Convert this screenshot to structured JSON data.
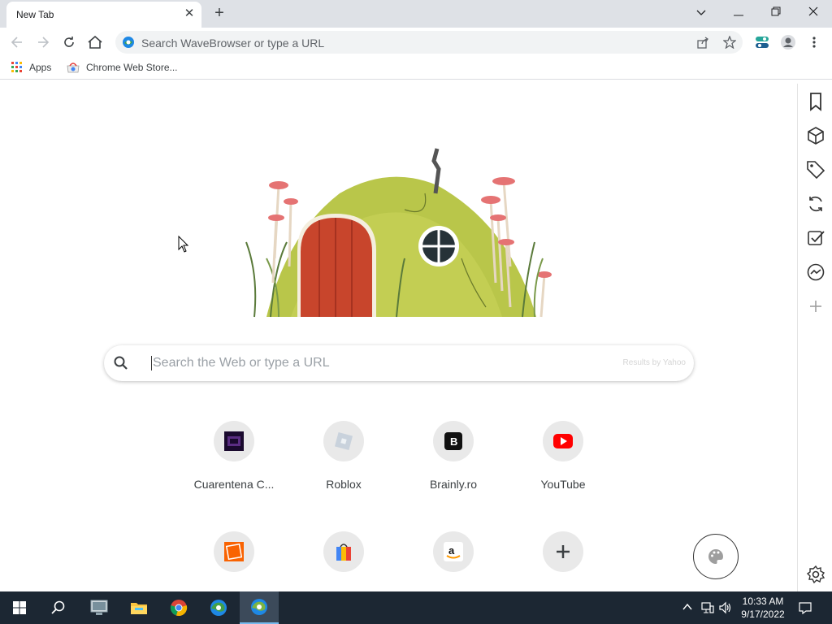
{
  "tab": {
    "title": "New Tab"
  },
  "window_controls": [
    "minimize",
    "restore",
    "close"
  ],
  "omnibox": {
    "placeholder": "Search WaveBrowser or type a URL"
  },
  "bookmarks": [
    {
      "label": "Apps",
      "icon": "apps-grid-icon"
    },
    {
      "label": "Chrome Web Store...",
      "icon": "chrome-web-store-icon"
    }
  ],
  "search": {
    "placeholder": "Search the Web or type a URL",
    "attribution": "Results by Yahoo"
  },
  "shortcuts": [
    {
      "label": "Cuarentena C...",
      "icon": "cuarentena-favicon"
    },
    {
      "label": "Roblox",
      "icon": "roblox-favicon"
    },
    {
      "label": "Brainly.ro",
      "icon": "brainly-favicon"
    },
    {
      "label": "YouTube",
      "icon": "youtube-favicon"
    },
    {
      "label": "",
      "icon": "home-depot-favicon"
    },
    {
      "label": "",
      "icon": "shopping-bag-favicon"
    },
    {
      "label": "",
      "icon": "amazon-favicon"
    },
    {
      "label": "",
      "icon": "add-shortcut-icon"
    }
  ],
  "sidebar": [
    "bookmark-icon",
    "package-icon",
    "tag-icon",
    "sync-icon",
    "checklist-icon",
    "messenger-icon",
    "add-icon",
    "settings-icon"
  ],
  "taskbar": {
    "time": "10:33 AM",
    "date": "9/17/2022",
    "colors": {
      "background": "#1c2733",
      "active": "#3c4a5a"
    }
  }
}
